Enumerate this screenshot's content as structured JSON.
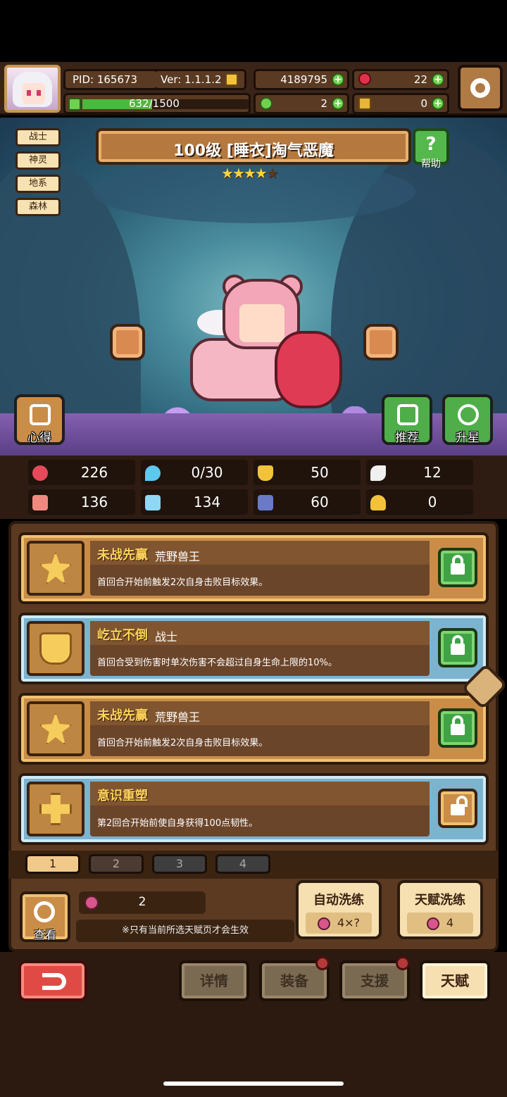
{
  "header": {
    "pid": "PID: 165673",
    "version": "Ver: 1.1.1.2",
    "xp": "632/1500",
    "xp_progress": 0.421,
    "gold": "4189795",
    "gems": "22",
    "clover": "2",
    "keys": "0"
  },
  "tags": [
    "战士",
    "神灵",
    "地系",
    "森林"
  ],
  "hero": {
    "title": "100级 [睡衣]淘气恶魔",
    "stars": 4,
    "stars_max": 5
  },
  "buttons": {
    "help": "帮助",
    "notes": "心得",
    "recommend": "推荐",
    "star_up": "升星"
  },
  "stats": {
    "hp": "226",
    "mana": "0/30",
    "shield": "50",
    "wing": "12",
    "attack": "136",
    "book": "134",
    "chest": "60",
    "horseshoe": "0"
  },
  "talents": [
    {
      "name": "未战先赢",
      "tag": "荒野兽王",
      "desc": "首回合开始前触发2次自身击败目标效果。",
      "locked": true,
      "icon": "star-icon"
    },
    {
      "name": "屹立不倒",
      "tag": "战士",
      "desc": "首回合受到伤害时单次伤害不会超过自身生命上限的10%。",
      "locked": true,
      "icon": "shield-icon"
    },
    {
      "name": "未战先赢",
      "tag": "荒野兽王",
      "desc": "首回合开始前触发2次自身击败目标效果。",
      "locked": true,
      "icon": "star-icon"
    },
    {
      "name": "意识重塑",
      "tag": "",
      "desc": "第2回合开始前使自身获得100点韧性。",
      "locked": false,
      "icon": "cross-icon"
    }
  ],
  "pages": [
    "1",
    "2",
    "3",
    "4"
  ],
  "bottom": {
    "view": "查看",
    "cost": "2",
    "note": "※只有当前所选天赋页才会生效",
    "auto_wash": "自动洗练",
    "auto_cost": "4×?",
    "talent_wash": "天赋洗练",
    "talent_cost": "4"
  },
  "tabs": {
    "details": "详情",
    "equip": "装备",
    "support": "支援",
    "talent": "天赋"
  }
}
